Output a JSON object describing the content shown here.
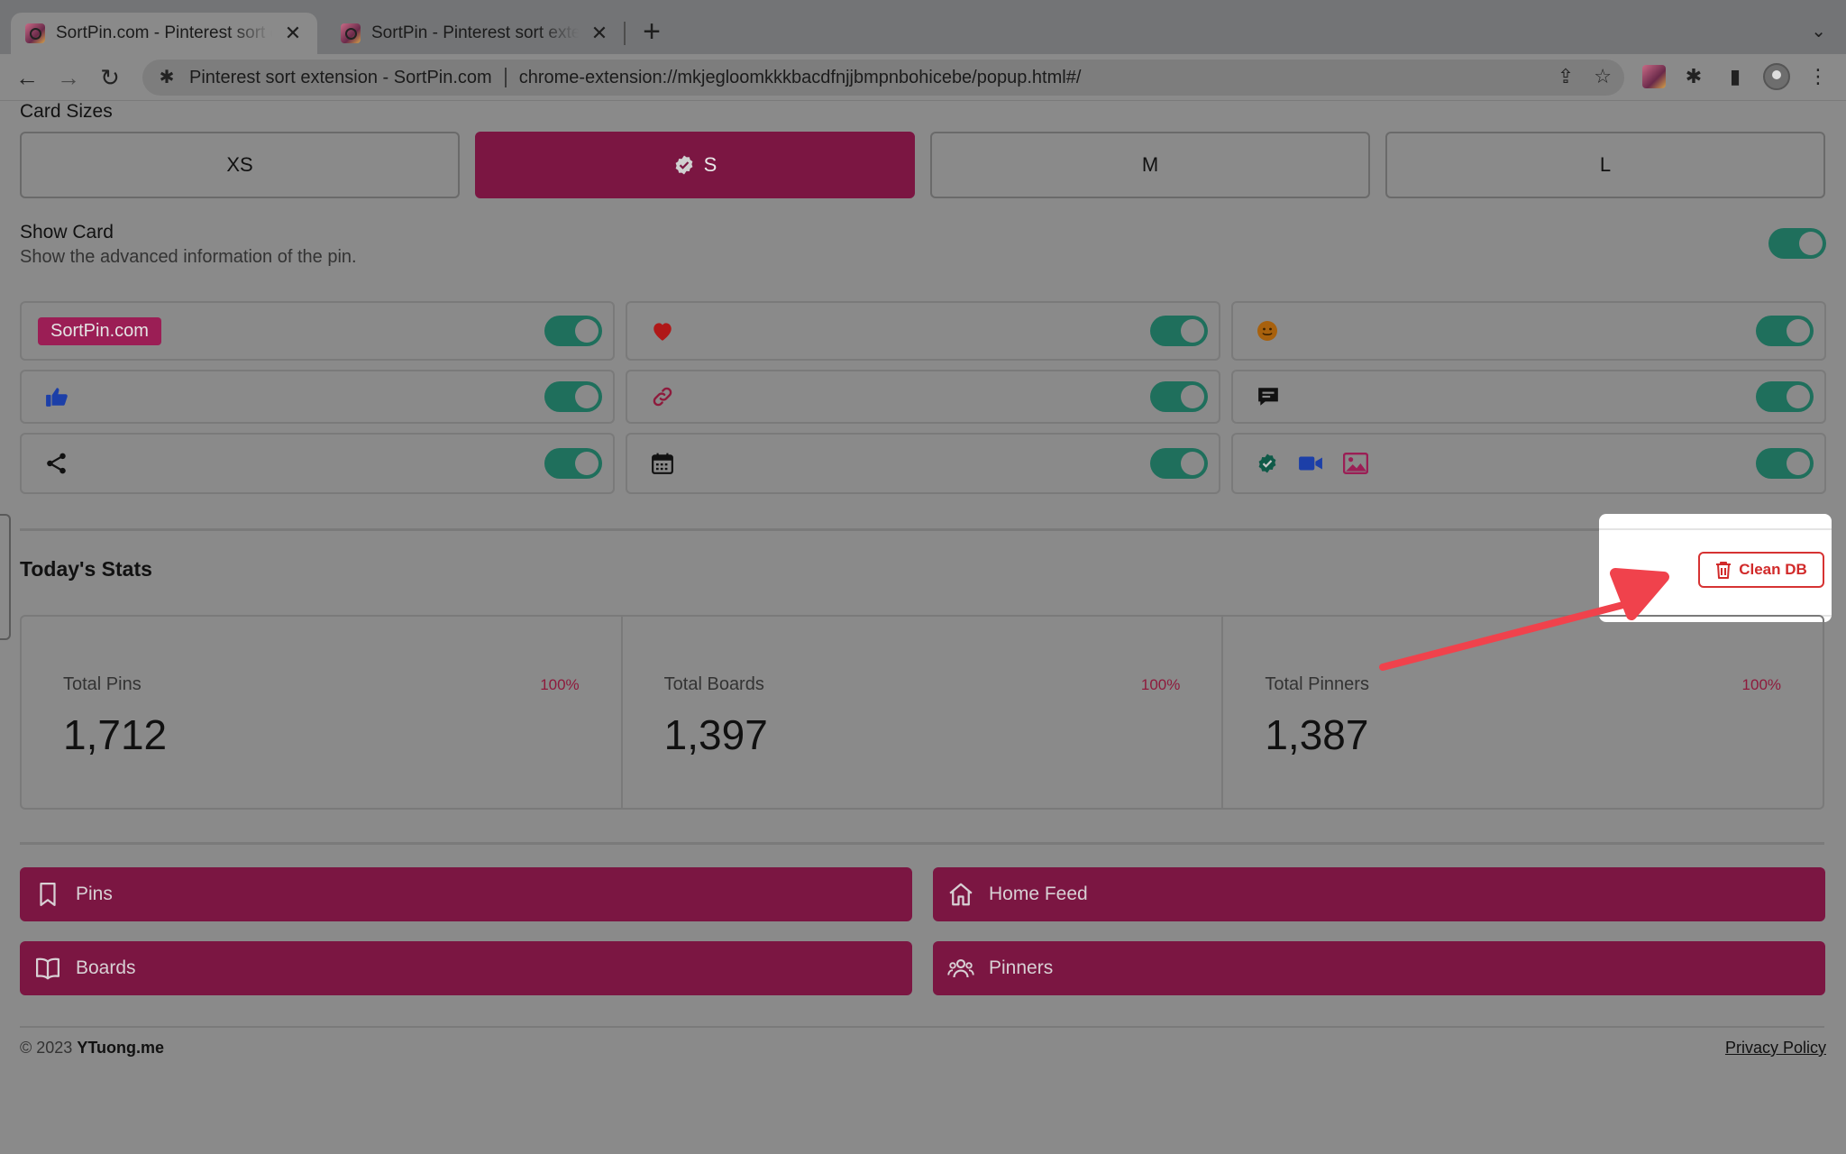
{
  "browser": {
    "tabs": [
      {
        "title": "SortPin.com - Pinterest sort extension",
        "active": true
      },
      {
        "title": "SortPin - Pinterest sort extension",
        "active": false
      }
    ],
    "site_name": "Pinterest sort extension - SortPin.com",
    "url": "chrome-extension://mkjegloomkkkbacdfnjjbmpnbohicebe/popup.html#/"
  },
  "card_sizes": {
    "title": "Card Sizes",
    "options": [
      "XS",
      "S",
      "M",
      "L"
    ],
    "selected": "S"
  },
  "show_card": {
    "title": "Show Card",
    "description": "Show the advanced information of the pin.",
    "enabled": true
  },
  "options": {
    "badge_label": "SortPin.com"
  },
  "stats": {
    "title": "Today's Stats",
    "clean_label": "Clean DB",
    "items": [
      {
        "label": "Total Pins",
        "percent": "100%",
        "value": "1,712"
      },
      {
        "label": "Total Boards",
        "percent": "100%",
        "value": "1,397"
      },
      {
        "label": "Total Pinners",
        "percent": "100%",
        "value": "1,387"
      }
    ]
  },
  "nav": {
    "pins": "Pins",
    "home_feed": "Home Feed",
    "boards": "Boards",
    "pinners": "Pinners"
  },
  "footer": {
    "copyright": "© 2023",
    "brand": "YTuong.me",
    "privacy": "Privacy Policy"
  },
  "colors": {
    "brand": "#7b1642",
    "toggle_on": "#1f6f5c",
    "danger": "#d12a2a",
    "annotation_arrow": "#f0424c"
  }
}
